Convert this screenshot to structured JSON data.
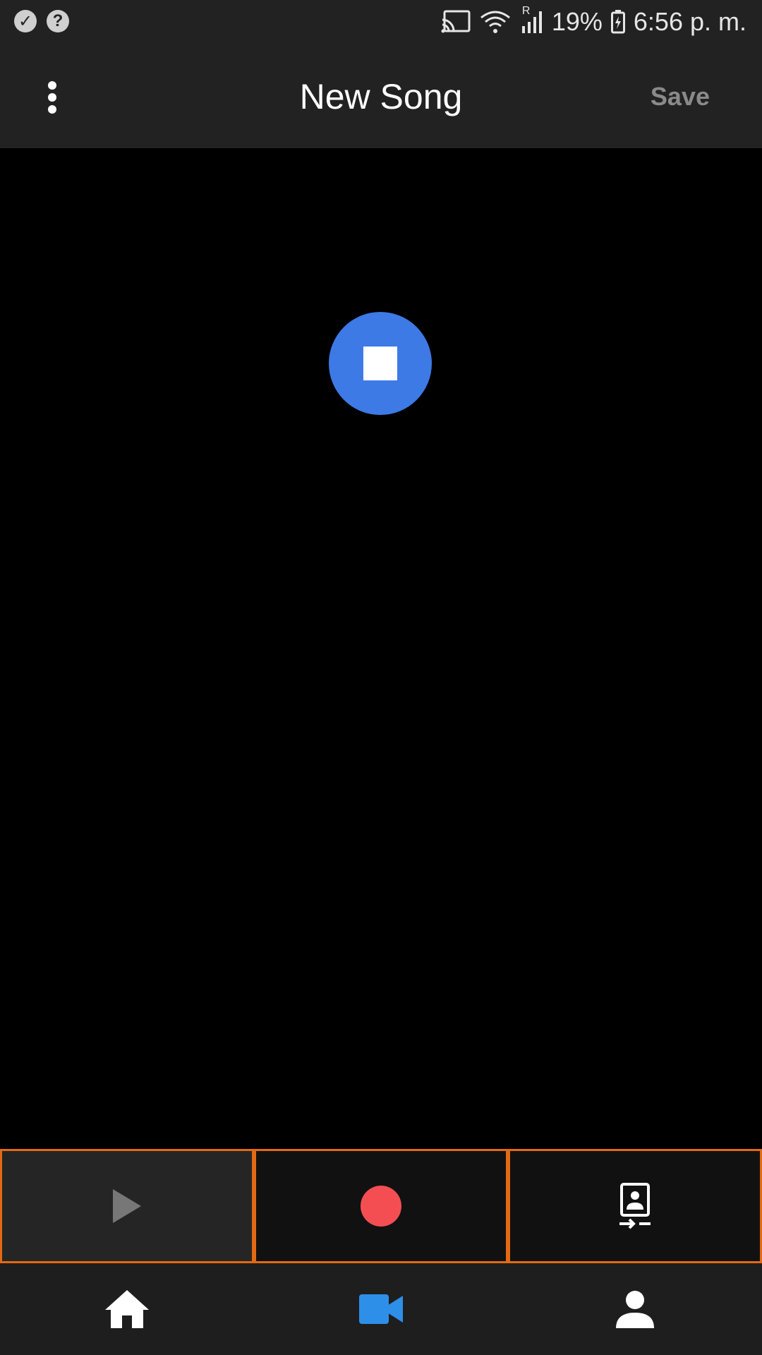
{
  "status_bar": {
    "left_icons": [
      "check-circle-icon",
      "help-circle-icon"
    ],
    "right_icons": [
      "cast-icon",
      "wifi-icon",
      "signal-icon",
      "battery-icon"
    ],
    "signal_roaming": "R",
    "battery": "19%",
    "time": "6:56 p. m."
  },
  "app_bar": {
    "menu_icon": "more-vert-icon",
    "title": "New Song",
    "save_label": "Save"
  },
  "main": {
    "fab_icon": "stop-icon",
    "fab_color": "#3d7ae6"
  },
  "controls": [
    {
      "icon": "play-icon",
      "color": "#777777"
    },
    {
      "icon": "record-icon",
      "color": "#f44e53"
    },
    {
      "icon": "switch-camera-icon",
      "color": "#ffffff"
    }
  ],
  "bottom_nav": [
    {
      "icon": "home-icon",
      "active": false,
      "color": "#ffffff"
    },
    {
      "icon": "video-camera-icon",
      "active": true,
      "color": "#2e8fe8"
    },
    {
      "icon": "person-icon",
      "active": false,
      "color": "#ffffff"
    }
  ],
  "accent_border_color": "#e36a12"
}
